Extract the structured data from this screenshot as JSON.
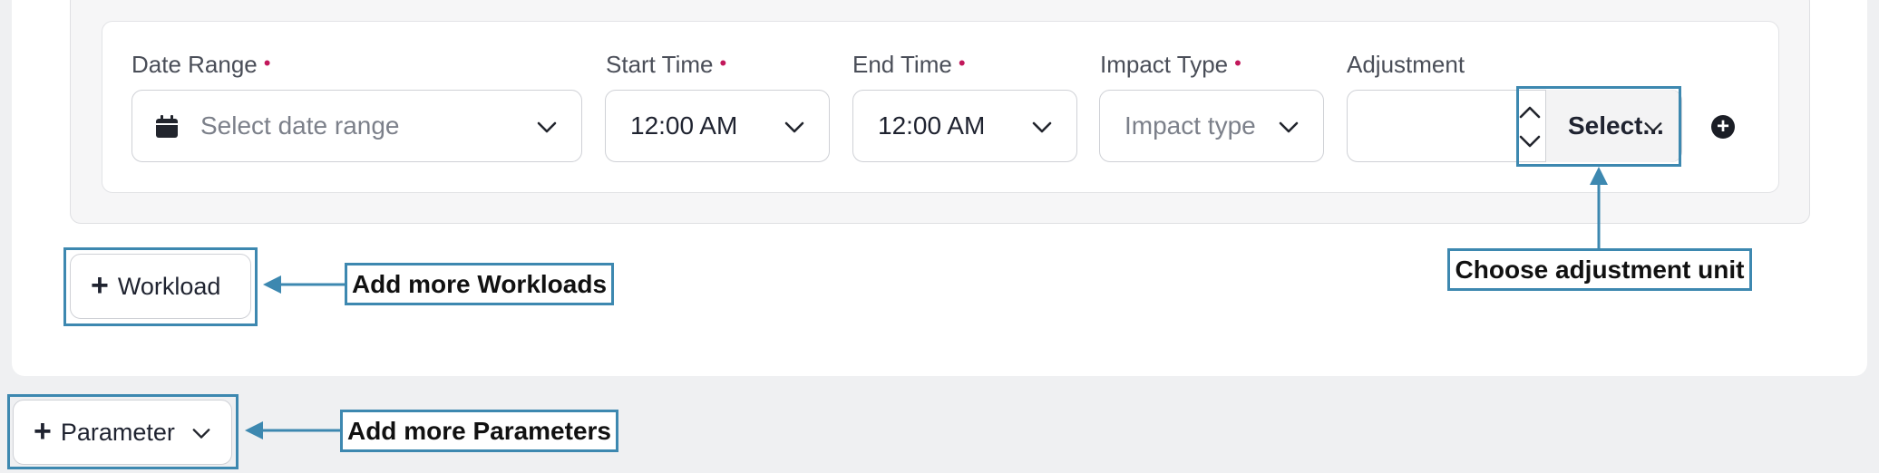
{
  "form": {
    "date_range": {
      "label": "Date Range",
      "required_mark": "•",
      "placeholder": "Select date range"
    },
    "start_time": {
      "label": "Start Time",
      "required_mark": "•",
      "value": "12:00 AM"
    },
    "end_time": {
      "label": "End Time",
      "required_mark": "•",
      "value": "12:00 AM"
    },
    "impact_type": {
      "label": "Impact Type",
      "required_mark": "•",
      "placeholder": "Impact type"
    },
    "adjustment": {
      "label": "Adjustment",
      "value": "",
      "unit_select": "Select..."
    },
    "add_row": "+"
  },
  "buttons": {
    "workload": "Workload",
    "parameter": "Parameter",
    "plus": "+"
  },
  "callouts": {
    "adjustment_unit": "Choose adjustment unit",
    "workloads": "Add more Workloads",
    "parameters": "Add more Parameters"
  },
  "colors": {
    "callout_border": "#3d88b0",
    "required": "#c2185b",
    "page_background": "#eff0f2"
  },
  "icons": [
    "calendar-icon",
    "chevron-down-icon",
    "stepper-icon",
    "plus-circle-icon",
    "plus-icon"
  ]
}
